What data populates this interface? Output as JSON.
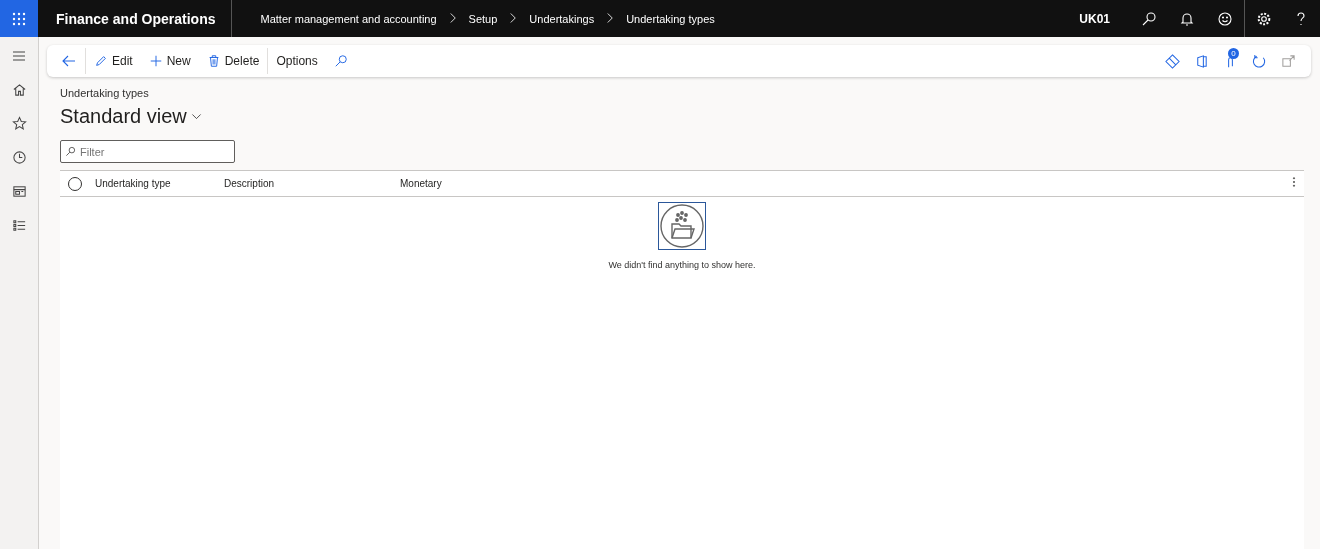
{
  "app_bar": {
    "title": "Finance and Operations",
    "breadcrumbs": [
      "Matter management and accounting",
      "Setup",
      "Undertakings",
      "Undertaking types"
    ],
    "company": "UK01"
  },
  "action_pane": {
    "buttons": [
      {
        "kind": "edit",
        "label": "Edit"
      },
      {
        "kind": "new",
        "label": "New"
      },
      {
        "kind": "delete",
        "label": "Delete"
      }
    ],
    "options": "Options",
    "attachments_count": "0"
  },
  "page": {
    "caption": "Undertaking types",
    "view": "Standard view"
  },
  "filter": {
    "placeholder": "Filter"
  },
  "grid": {
    "all_selected": false,
    "columns": [
      "Undertaking type",
      "Description",
      "Monetary"
    ],
    "empty_message": "We didn't find anything to show here."
  }
}
